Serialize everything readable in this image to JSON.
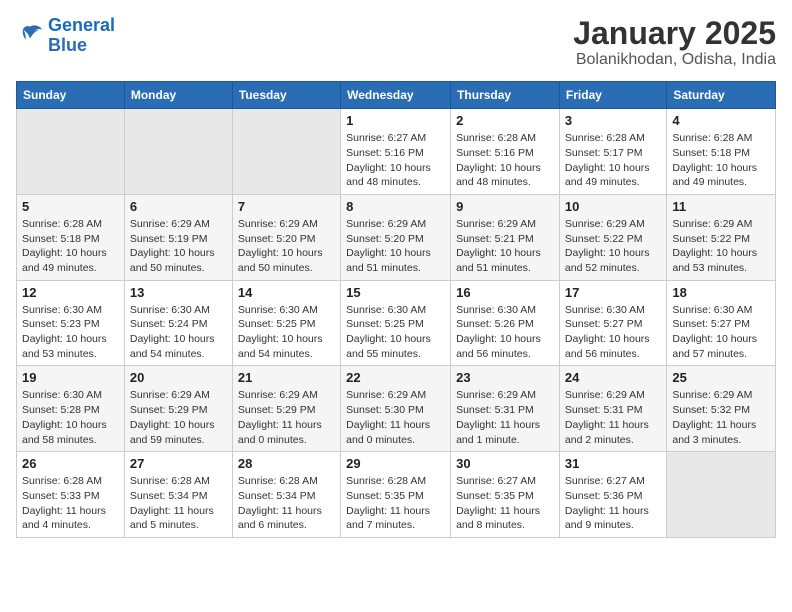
{
  "logo": {
    "line1": "General",
    "line2": "Blue"
  },
  "title": "January 2025",
  "location": "Bolanikhodan, Odisha, India",
  "weekdays": [
    "Sunday",
    "Monday",
    "Tuesday",
    "Wednesday",
    "Thursday",
    "Friday",
    "Saturday"
  ],
  "weeks": [
    [
      {
        "day": "",
        "info": ""
      },
      {
        "day": "",
        "info": ""
      },
      {
        "day": "",
        "info": ""
      },
      {
        "day": "1",
        "info": "Sunrise: 6:27 AM\nSunset: 5:16 PM\nDaylight: 10 hours\nand 48 minutes."
      },
      {
        "day": "2",
        "info": "Sunrise: 6:28 AM\nSunset: 5:16 PM\nDaylight: 10 hours\nand 48 minutes."
      },
      {
        "day": "3",
        "info": "Sunrise: 6:28 AM\nSunset: 5:17 PM\nDaylight: 10 hours\nand 49 minutes."
      },
      {
        "day": "4",
        "info": "Sunrise: 6:28 AM\nSunset: 5:18 PM\nDaylight: 10 hours\nand 49 minutes."
      }
    ],
    [
      {
        "day": "5",
        "info": "Sunrise: 6:28 AM\nSunset: 5:18 PM\nDaylight: 10 hours\nand 49 minutes."
      },
      {
        "day": "6",
        "info": "Sunrise: 6:29 AM\nSunset: 5:19 PM\nDaylight: 10 hours\nand 50 minutes."
      },
      {
        "day": "7",
        "info": "Sunrise: 6:29 AM\nSunset: 5:20 PM\nDaylight: 10 hours\nand 50 minutes."
      },
      {
        "day": "8",
        "info": "Sunrise: 6:29 AM\nSunset: 5:20 PM\nDaylight: 10 hours\nand 51 minutes."
      },
      {
        "day": "9",
        "info": "Sunrise: 6:29 AM\nSunset: 5:21 PM\nDaylight: 10 hours\nand 51 minutes."
      },
      {
        "day": "10",
        "info": "Sunrise: 6:29 AM\nSunset: 5:22 PM\nDaylight: 10 hours\nand 52 minutes."
      },
      {
        "day": "11",
        "info": "Sunrise: 6:29 AM\nSunset: 5:22 PM\nDaylight: 10 hours\nand 53 minutes."
      }
    ],
    [
      {
        "day": "12",
        "info": "Sunrise: 6:30 AM\nSunset: 5:23 PM\nDaylight: 10 hours\nand 53 minutes."
      },
      {
        "day": "13",
        "info": "Sunrise: 6:30 AM\nSunset: 5:24 PM\nDaylight: 10 hours\nand 54 minutes."
      },
      {
        "day": "14",
        "info": "Sunrise: 6:30 AM\nSunset: 5:25 PM\nDaylight: 10 hours\nand 54 minutes."
      },
      {
        "day": "15",
        "info": "Sunrise: 6:30 AM\nSunset: 5:25 PM\nDaylight: 10 hours\nand 55 minutes."
      },
      {
        "day": "16",
        "info": "Sunrise: 6:30 AM\nSunset: 5:26 PM\nDaylight: 10 hours\nand 56 minutes."
      },
      {
        "day": "17",
        "info": "Sunrise: 6:30 AM\nSunset: 5:27 PM\nDaylight: 10 hours\nand 56 minutes."
      },
      {
        "day": "18",
        "info": "Sunrise: 6:30 AM\nSunset: 5:27 PM\nDaylight: 10 hours\nand 57 minutes."
      }
    ],
    [
      {
        "day": "19",
        "info": "Sunrise: 6:30 AM\nSunset: 5:28 PM\nDaylight: 10 hours\nand 58 minutes."
      },
      {
        "day": "20",
        "info": "Sunrise: 6:29 AM\nSunset: 5:29 PM\nDaylight: 10 hours\nand 59 minutes."
      },
      {
        "day": "21",
        "info": "Sunrise: 6:29 AM\nSunset: 5:29 PM\nDaylight: 11 hours\nand 0 minutes."
      },
      {
        "day": "22",
        "info": "Sunrise: 6:29 AM\nSunset: 5:30 PM\nDaylight: 11 hours\nand 0 minutes."
      },
      {
        "day": "23",
        "info": "Sunrise: 6:29 AM\nSunset: 5:31 PM\nDaylight: 11 hours\nand 1 minute."
      },
      {
        "day": "24",
        "info": "Sunrise: 6:29 AM\nSunset: 5:31 PM\nDaylight: 11 hours\nand 2 minutes."
      },
      {
        "day": "25",
        "info": "Sunrise: 6:29 AM\nSunset: 5:32 PM\nDaylight: 11 hours\nand 3 minutes."
      }
    ],
    [
      {
        "day": "26",
        "info": "Sunrise: 6:28 AM\nSunset: 5:33 PM\nDaylight: 11 hours\nand 4 minutes."
      },
      {
        "day": "27",
        "info": "Sunrise: 6:28 AM\nSunset: 5:34 PM\nDaylight: 11 hours\nand 5 minutes."
      },
      {
        "day": "28",
        "info": "Sunrise: 6:28 AM\nSunset: 5:34 PM\nDaylight: 11 hours\nand 6 minutes."
      },
      {
        "day": "29",
        "info": "Sunrise: 6:28 AM\nSunset: 5:35 PM\nDaylight: 11 hours\nand 7 minutes."
      },
      {
        "day": "30",
        "info": "Sunrise: 6:27 AM\nSunset: 5:35 PM\nDaylight: 11 hours\nand 8 minutes."
      },
      {
        "day": "31",
        "info": "Sunrise: 6:27 AM\nSunset: 5:36 PM\nDaylight: 11 hours\nand 9 minutes."
      },
      {
        "day": "",
        "info": ""
      }
    ]
  ]
}
